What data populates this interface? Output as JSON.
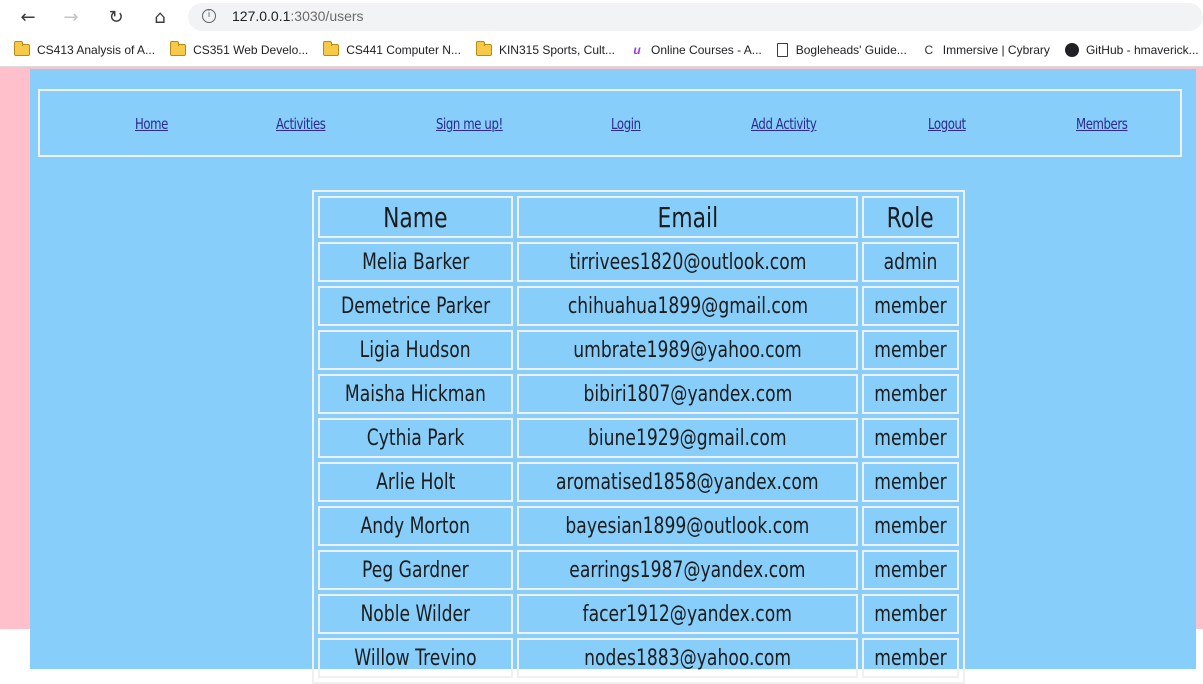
{
  "browser": {
    "url_host": "127.0.0.1",
    "url_path": ":3030/users",
    "back_glyph": "←",
    "forward_glyph": "→",
    "reload_glyph": "↻",
    "home_glyph": "⌂",
    "info_glyph": "i"
  },
  "bookmarks": [
    {
      "label": "CS413 Analysis of A...",
      "icon": "folder-icon"
    },
    {
      "label": "CS351 Web Develo...",
      "icon": "folder-icon"
    },
    {
      "label": "CS441 Computer N...",
      "icon": "folder-icon"
    },
    {
      "label": "KIN315 Sports, Cult...",
      "icon": "folder-icon"
    },
    {
      "label": "Online Courses - A...",
      "icon": "udemy-icon"
    },
    {
      "label": "Bogleheads' Guide...",
      "icon": "document-icon"
    },
    {
      "label": "Immersive | Cybrary",
      "icon": "cybrary-icon"
    },
    {
      "label": "GitHub - hmaverick...",
      "icon": "github-icon"
    }
  ],
  "nav": {
    "home": "Home",
    "activities": "Activities",
    "signup": "Sign me up!",
    "login": "Login",
    "add_activity": "Add Activity",
    "logout": "Logout",
    "members": "Members"
  },
  "table": {
    "headers": [
      "Name",
      "Email",
      "Role"
    ],
    "rows": [
      [
        "Melia Barker",
        "tirrivees1820@outlook.com",
        "admin"
      ],
      [
        "Demetrice Parker",
        "chihuahua1899@gmail.com",
        "member"
      ],
      [
        "Ligia Hudson",
        "umbrate1989@yahoo.com",
        "member"
      ],
      [
        "Maisha Hickman",
        "bibiri1807@yandex.com",
        "member"
      ],
      [
        "Cythia Park",
        "biune1929@gmail.com",
        "member"
      ],
      [
        "Arlie Holt",
        "aromatised1858@yandex.com",
        "member"
      ],
      [
        "Andy Morton",
        "bayesian1899@outlook.com",
        "member"
      ],
      [
        "Peg Gardner",
        "earrings1987@yandex.com",
        "member"
      ],
      [
        "Noble Wilder",
        "facer1912@yandex.com",
        "member"
      ],
      [
        "Willow Trevino",
        "nodes1883@yahoo.com",
        "member"
      ]
    ]
  },
  "colors": {
    "page_background": "#ffc0cb",
    "content_background": "#87cefa",
    "link": "#2e2a8c",
    "border": "#f0f0f0"
  }
}
